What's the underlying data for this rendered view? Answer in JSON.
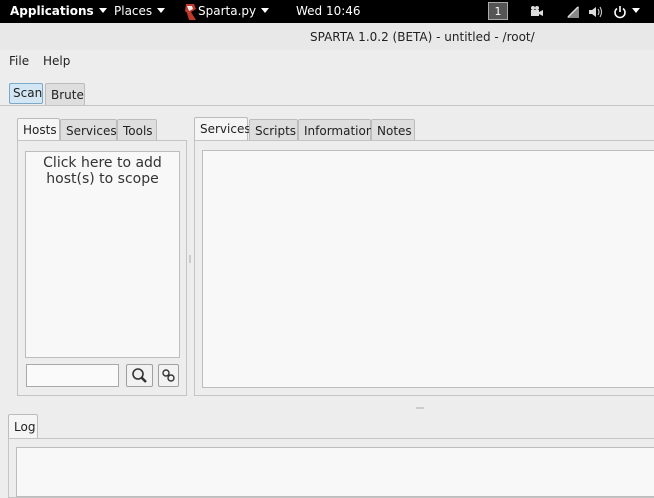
{
  "topbar": {
    "applications": "Applications",
    "places": "Places",
    "app_name": "Sparta.py",
    "clock": "Wed 10:46",
    "workspace": "1"
  },
  "window": {
    "title": "SPARTA 1.0.2 (BETA) - untitled - /root/"
  },
  "menubar": {
    "file": "File",
    "help": "Help"
  },
  "main_tabs": {
    "scan": "Scan",
    "brute": "Brute"
  },
  "left_tabs": {
    "hosts": "Hosts",
    "services": "Services",
    "tools": "Tools"
  },
  "hosts_panel": {
    "scope_line1": "Click here to add",
    "scope_line2": "host(s) to scope",
    "search_value": ""
  },
  "right_tabs": {
    "services": "Services",
    "scripts": "Scripts",
    "information": "Information",
    "notes": "Notes"
  },
  "log": {
    "tab": "Log"
  }
}
